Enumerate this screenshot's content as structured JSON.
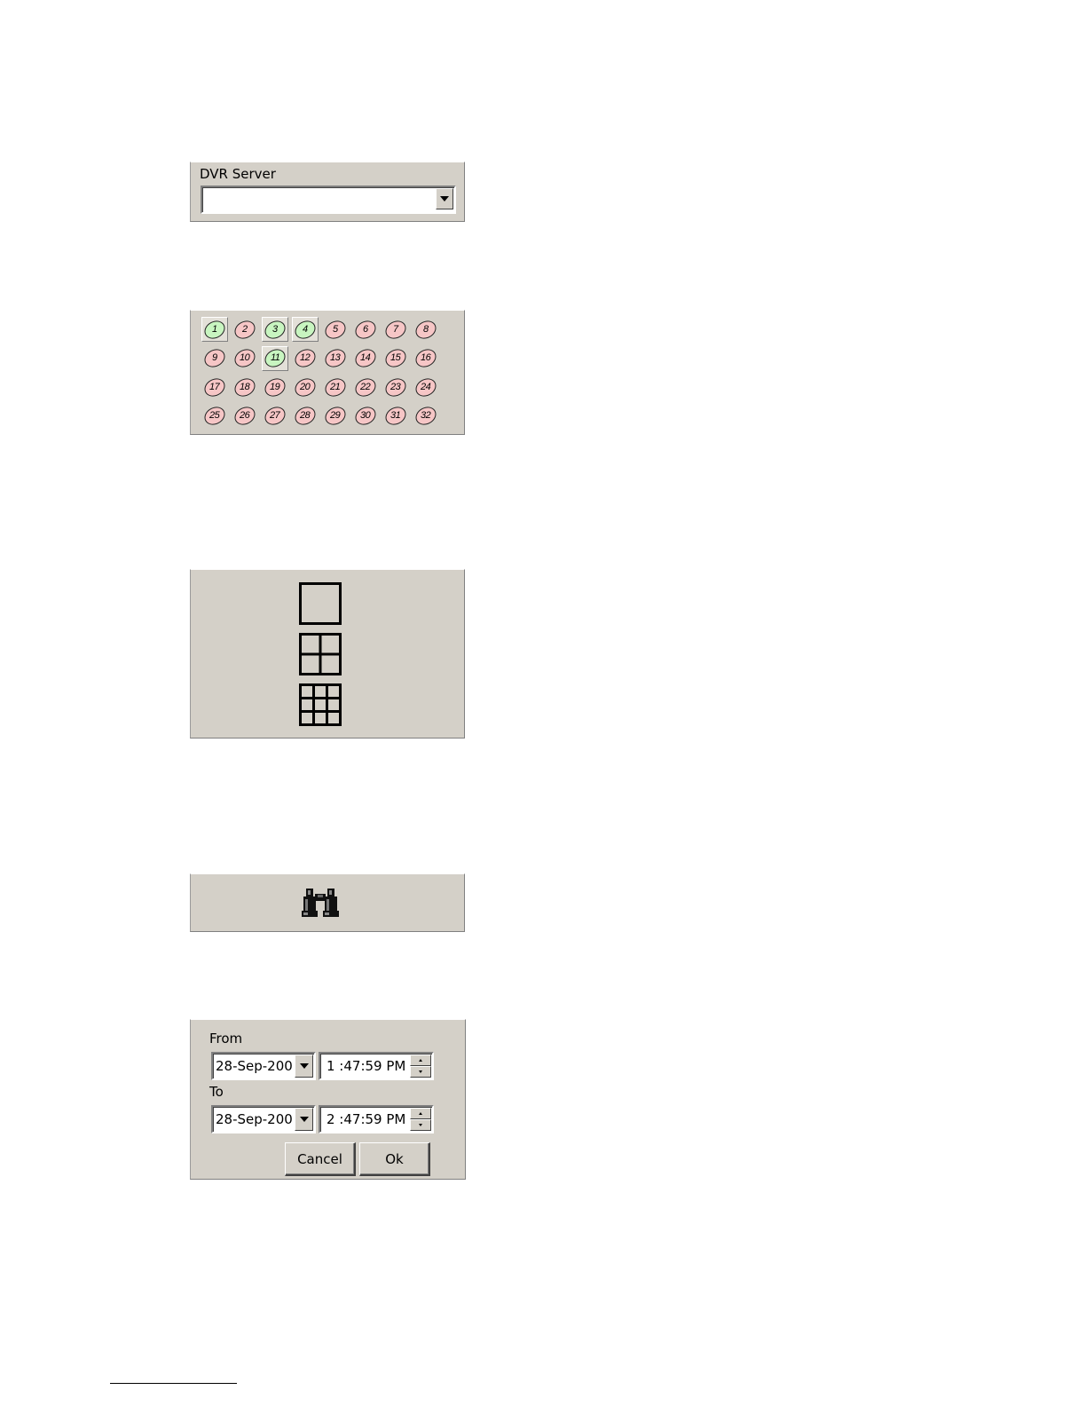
{
  "server_panel": {
    "label": "DVR Server",
    "value": ""
  },
  "cameras": [
    {
      "label": "1",
      "status": "active",
      "selected": true
    },
    {
      "label": "2",
      "status": "inactive",
      "selected": false
    },
    {
      "label": "3",
      "status": "active",
      "selected": true
    },
    {
      "label": "4",
      "status": "active",
      "selected": true
    },
    {
      "label": "5",
      "status": "inactive",
      "selected": false
    },
    {
      "label": "6",
      "status": "inactive",
      "selected": false
    },
    {
      "label": "7",
      "status": "inactive",
      "selected": false
    },
    {
      "label": "8",
      "status": "inactive",
      "selected": false
    },
    {
      "label": "9",
      "status": "inactive",
      "selected": false
    },
    {
      "label": "10",
      "status": "inactive",
      "selected": false
    },
    {
      "label": "11",
      "status": "active",
      "selected": true
    },
    {
      "label": "12",
      "status": "inactive",
      "selected": false
    },
    {
      "label": "13",
      "status": "inactive",
      "selected": false
    },
    {
      "label": "14",
      "status": "inactive",
      "selected": false
    },
    {
      "label": "15",
      "status": "inactive",
      "selected": false
    },
    {
      "label": "16",
      "status": "inactive",
      "selected": false
    },
    {
      "label": "17",
      "status": "inactive",
      "selected": false
    },
    {
      "label": "18",
      "status": "inactive",
      "selected": false
    },
    {
      "label": "19",
      "status": "inactive",
      "selected": false
    },
    {
      "label": "20",
      "status": "inactive",
      "selected": false
    },
    {
      "label": "21",
      "status": "inactive",
      "selected": false
    },
    {
      "label": "22",
      "status": "inactive",
      "selected": false
    },
    {
      "label": "23",
      "status": "inactive",
      "selected": false
    },
    {
      "label": "24",
      "status": "inactive",
      "selected": false
    },
    {
      "label": "25",
      "status": "inactive",
      "selected": false
    },
    {
      "label": "26",
      "status": "inactive",
      "selected": false
    },
    {
      "label": "27",
      "status": "inactive",
      "selected": false
    },
    {
      "label": "28",
      "status": "inactive",
      "selected": false
    },
    {
      "label": "29",
      "status": "inactive",
      "selected": false
    },
    {
      "label": "30",
      "status": "inactive",
      "selected": false
    },
    {
      "label": "31",
      "status": "inactive",
      "selected": false
    },
    {
      "label": "32",
      "status": "inactive",
      "selected": false
    }
  ],
  "camera_colors": {
    "active": "#c8f5c0",
    "inactive": "#f6c6c6"
  },
  "layouts": [
    {
      "name": "single-view-icon",
      "divisions": 1
    },
    {
      "name": "quad-view-icon",
      "divisions": 2
    },
    {
      "name": "nine-view-icon",
      "divisions": 3
    }
  ],
  "search": {
    "icon": "binoculars-icon"
  },
  "range": {
    "from_label": "From",
    "from_date": "28-Sep-200",
    "from_time": "1 :47:59 PM",
    "to_label": "To",
    "to_date": "28-Sep-200",
    "to_time": "2 :47:59 PM",
    "cancel_label": "Cancel",
    "ok_label": "Ok"
  },
  "colors": {
    "panel": "#d4d0c8"
  }
}
